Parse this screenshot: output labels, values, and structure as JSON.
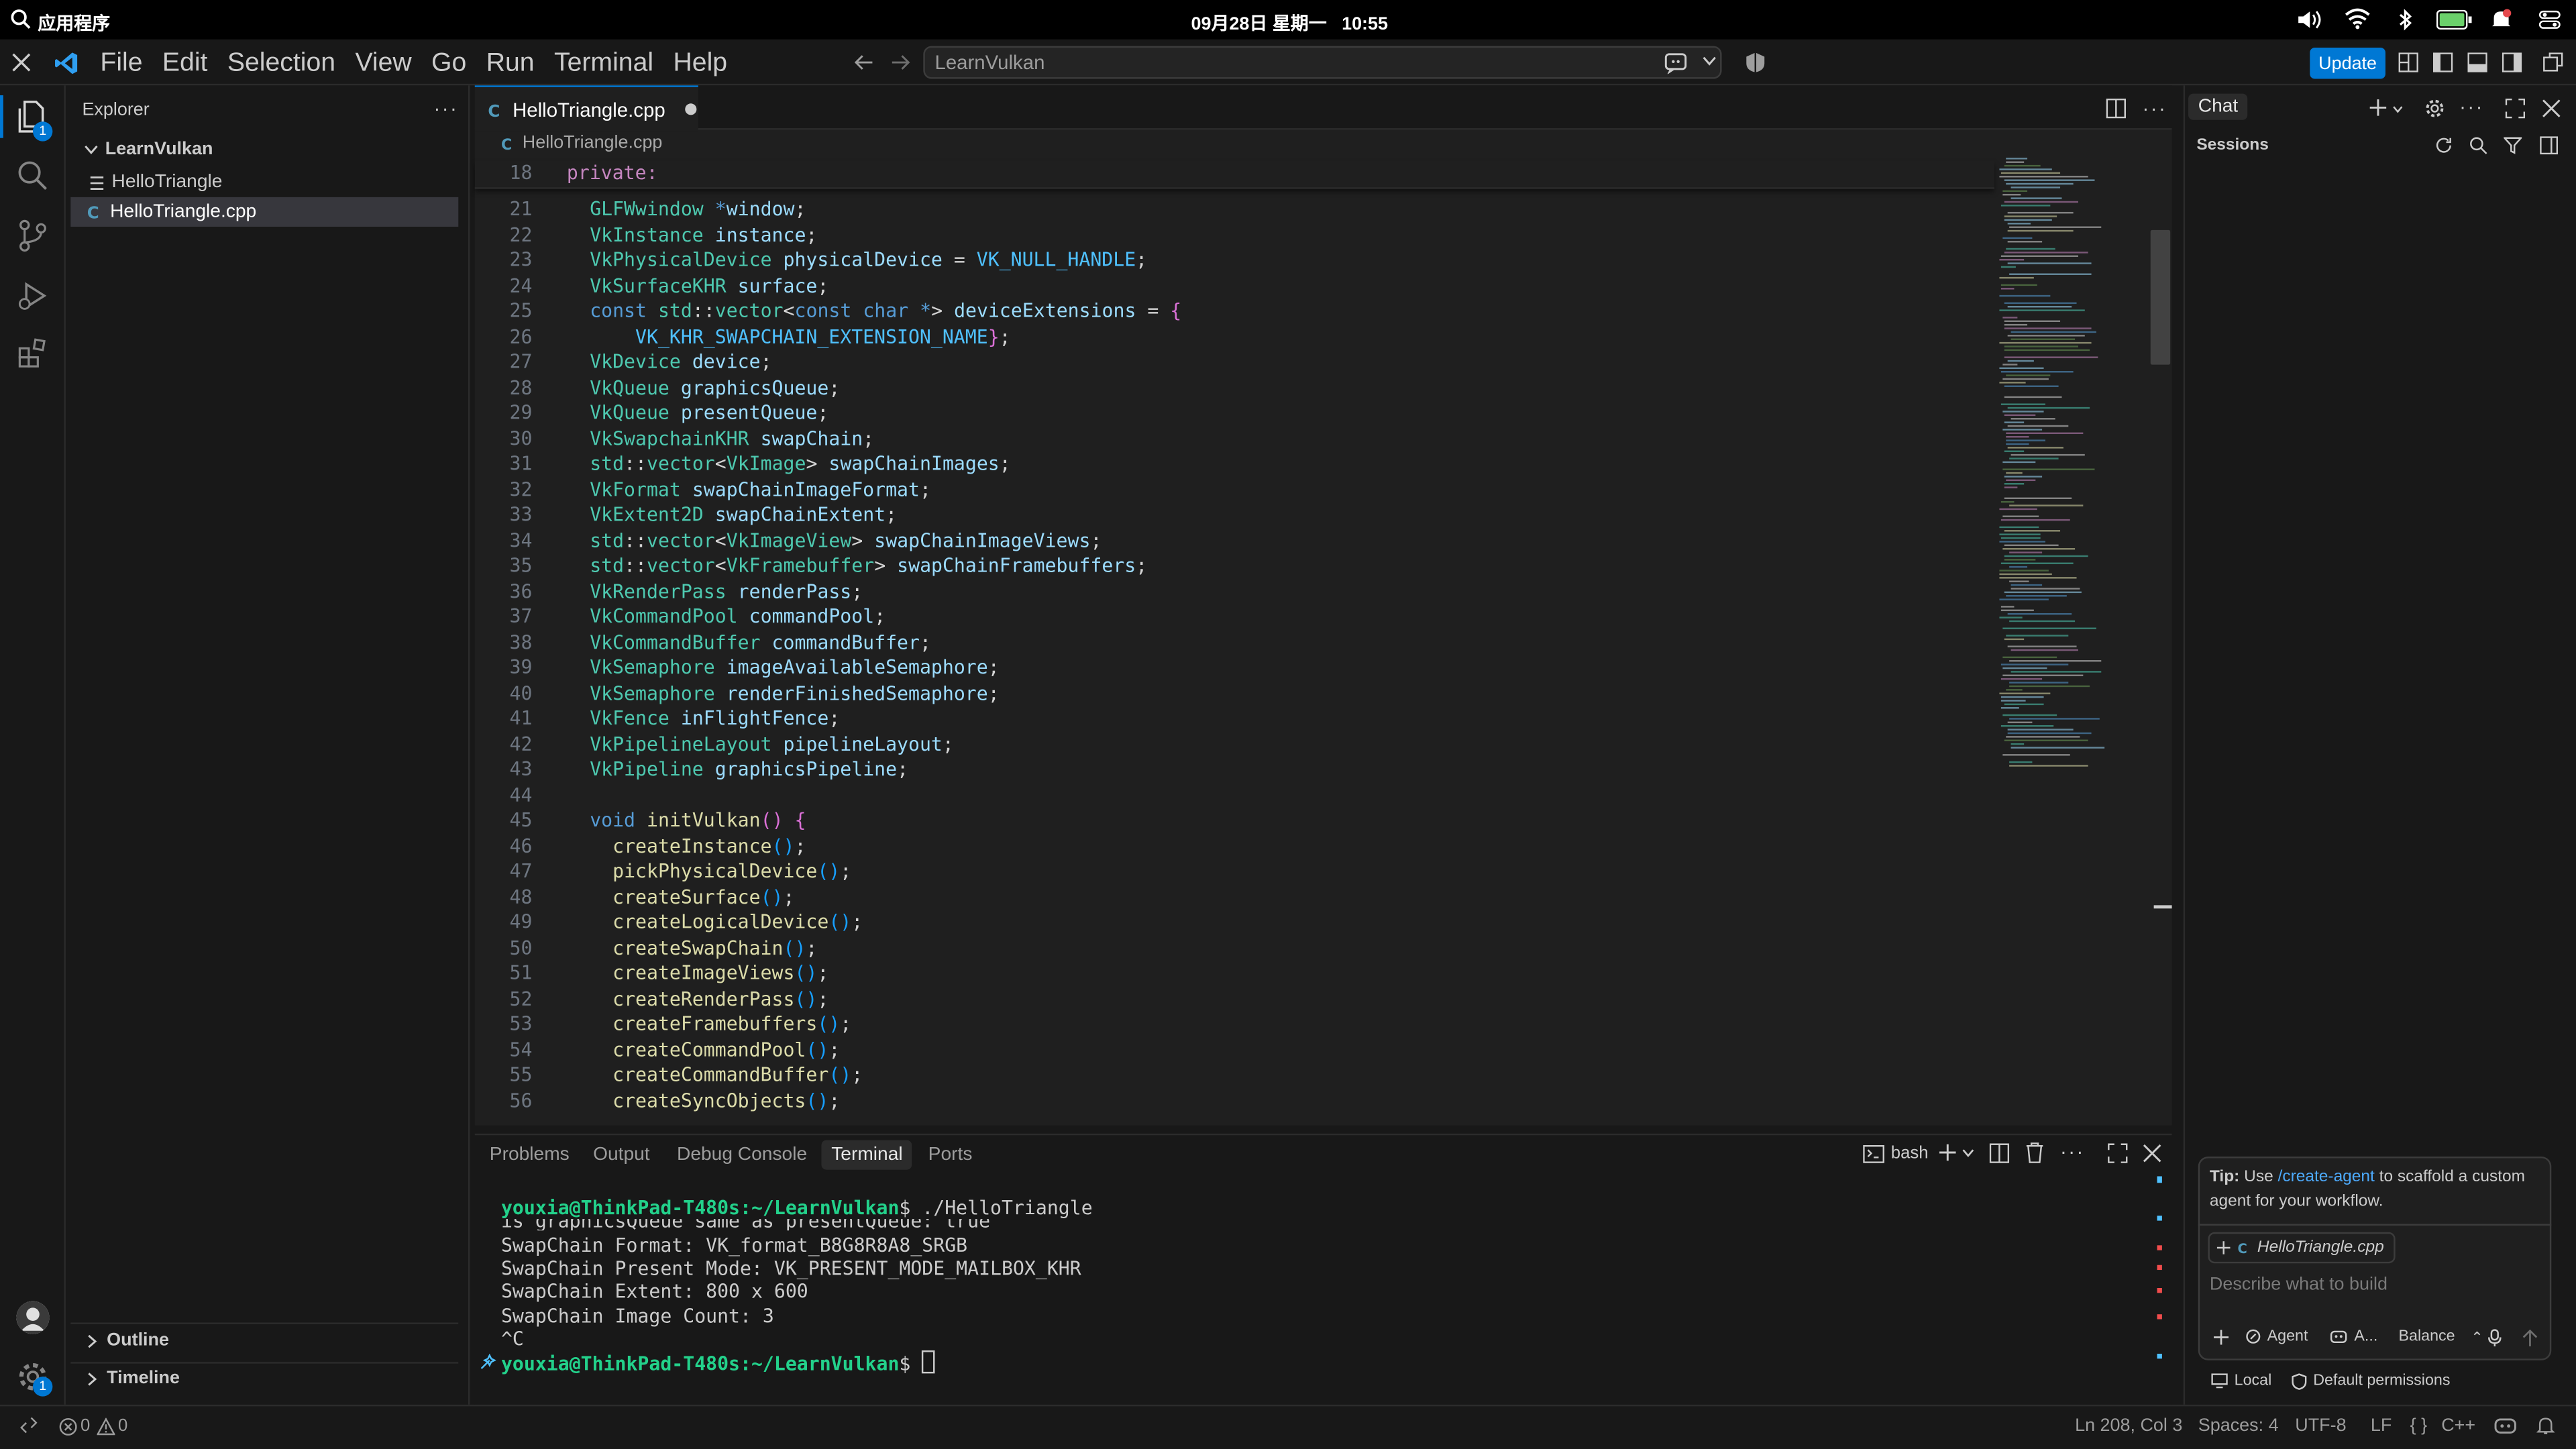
{
  "os_bar": {
    "app_menu": "应用程序",
    "datetime": "09月28日 星期一   10:55"
  },
  "menu": {
    "items": [
      "File",
      "Edit",
      "Selection",
      "View",
      "Go",
      "Run",
      "Terminal",
      "Help"
    ]
  },
  "command_center": {
    "text": "LearnVulkan"
  },
  "update_button": "Update",
  "sidebar": {
    "title": "Explorer",
    "root_folder": "LearnVulkan",
    "files": [
      {
        "name": "HelloTriangle",
        "selected": false
      },
      {
        "name": "HelloTriangle.cpp",
        "selected": true
      }
    ],
    "outline": "Outline",
    "timeline": "Timeline"
  },
  "activity": {
    "explorer_badge": "1",
    "settings_badge": "1"
  },
  "editor": {
    "tab_label": "HelloTriangle.cpp",
    "tab_modified": true,
    "breadcrumb": "HelloTriangle.cpp",
    "sticky_line": {
      "number": "18",
      "text": "private:"
    },
    "lines": [
      {
        "n": "21",
        "tokens": [
          [
            "t",
            "GLFWwindow"
          ],
          [
            "d",
            " "
          ],
          [
            "k",
            "*"
          ],
          [
            "v",
            "window"
          ],
          [
            "d",
            ";"
          ]
        ]
      },
      {
        "n": "22",
        "tokens": [
          [
            "t",
            "VkInstance"
          ],
          [
            "d",
            " "
          ],
          [
            "v",
            "instance"
          ],
          [
            "d",
            ";"
          ]
        ]
      },
      {
        "n": "23",
        "tokens": [
          [
            "t",
            "VkPhysicalDevice"
          ],
          [
            "d",
            " "
          ],
          [
            "v",
            "physicalDevice"
          ],
          [
            "d",
            " = "
          ],
          [
            "c",
            "VK_NULL_HANDLE"
          ],
          [
            "d",
            ";"
          ]
        ]
      },
      {
        "n": "24",
        "tokens": [
          [
            "t",
            "VkSurfaceKHR"
          ],
          [
            "d",
            " "
          ],
          [
            "v",
            "surface"
          ],
          [
            "d",
            ";"
          ]
        ]
      },
      {
        "n": "25",
        "tokens": [
          [
            "k",
            "const"
          ],
          [
            "d",
            " "
          ],
          [
            "t",
            "std"
          ],
          [
            "d",
            "::"
          ],
          [
            "t",
            "vector"
          ],
          [
            "d",
            "<"
          ],
          [
            "k",
            "const"
          ],
          [
            "d",
            " "
          ],
          [
            "k",
            "char"
          ],
          [
            "d",
            " "
          ],
          [
            "k",
            "*"
          ],
          [
            "d",
            "> "
          ],
          [
            "v",
            "deviceExtensions"
          ],
          [
            "d",
            " = "
          ],
          [
            "p",
            "{"
          ]
        ]
      },
      {
        "n": "26",
        "tokens": [
          [
            "d",
            "    "
          ],
          [
            "c",
            "VK_KHR_SWAPCHAIN_EXTENSION_NAME"
          ],
          [
            "p",
            "}"
          ],
          [
            "d",
            ";"
          ]
        ]
      },
      {
        "n": "27",
        "tokens": [
          [
            "t",
            "VkDevice"
          ],
          [
            "d",
            " "
          ],
          [
            "v",
            "device"
          ],
          [
            "d",
            ";"
          ]
        ]
      },
      {
        "n": "28",
        "tokens": [
          [
            "t",
            "VkQueue"
          ],
          [
            "d",
            " "
          ],
          [
            "v",
            "graphicsQueue"
          ],
          [
            "d",
            ";"
          ]
        ]
      },
      {
        "n": "29",
        "tokens": [
          [
            "t",
            "VkQueue"
          ],
          [
            "d",
            " "
          ],
          [
            "v",
            "presentQueue"
          ],
          [
            "d",
            ";"
          ]
        ]
      },
      {
        "n": "30",
        "tokens": [
          [
            "t",
            "VkSwapchainKHR"
          ],
          [
            "d",
            " "
          ],
          [
            "v",
            "swapChain"
          ],
          [
            "d",
            ";"
          ]
        ]
      },
      {
        "n": "31",
        "tokens": [
          [
            "t",
            "std"
          ],
          [
            "d",
            "::"
          ],
          [
            "t",
            "vector"
          ],
          [
            "d",
            "<"
          ],
          [
            "t",
            "VkImage"
          ],
          [
            "d",
            "> "
          ],
          [
            "v",
            "swapChainImages"
          ],
          [
            "d",
            ";"
          ]
        ]
      },
      {
        "n": "32",
        "tokens": [
          [
            "t",
            "VkFormat"
          ],
          [
            "d",
            " "
          ],
          [
            "v",
            "swapChainImageFormat"
          ],
          [
            "d",
            ";"
          ]
        ]
      },
      {
        "n": "33",
        "tokens": [
          [
            "t",
            "VkExtent2D"
          ],
          [
            "d",
            " "
          ],
          [
            "v",
            "swapChainExtent"
          ],
          [
            "d",
            ";"
          ]
        ]
      },
      {
        "n": "34",
        "tokens": [
          [
            "t",
            "std"
          ],
          [
            "d",
            "::"
          ],
          [
            "t",
            "vector"
          ],
          [
            "d",
            "<"
          ],
          [
            "t",
            "VkImageView"
          ],
          [
            "d",
            "> "
          ],
          [
            "v",
            "swapChainImageViews"
          ],
          [
            "d",
            ";"
          ]
        ]
      },
      {
        "n": "35",
        "tokens": [
          [
            "t",
            "std"
          ],
          [
            "d",
            "::"
          ],
          [
            "t",
            "vector"
          ],
          [
            "d",
            "<"
          ],
          [
            "t",
            "VkFramebuffer"
          ],
          [
            "d",
            "> "
          ],
          [
            "v",
            "swapChainFramebuffers"
          ],
          [
            "d",
            ";"
          ]
        ]
      },
      {
        "n": "36",
        "tokens": [
          [
            "t",
            "VkRenderPass"
          ],
          [
            "d",
            " "
          ],
          [
            "v",
            "renderPass"
          ],
          [
            "d",
            ";"
          ]
        ]
      },
      {
        "n": "37",
        "tokens": [
          [
            "t",
            "VkCommandPool"
          ],
          [
            "d",
            " "
          ],
          [
            "v",
            "commandPool"
          ],
          [
            "d",
            ";"
          ]
        ]
      },
      {
        "n": "38",
        "tokens": [
          [
            "t",
            "VkCommandBuffer"
          ],
          [
            "d",
            " "
          ],
          [
            "v",
            "commandBuffer"
          ],
          [
            "d",
            ";"
          ]
        ]
      },
      {
        "n": "39",
        "tokens": [
          [
            "t",
            "VkSemaphore"
          ],
          [
            "d",
            " "
          ],
          [
            "v",
            "imageAvailableSemaphore"
          ],
          [
            "d",
            ";"
          ]
        ]
      },
      {
        "n": "40",
        "tokens": [
          [
            "t",
            "VkSemaphore"
          ],
          [
            "d",
            " "
          ],
          [
            "v",
            "renderFinishedSemaphore"
          ],
          [
            "d",
            ";"
          ]
        ]
      },
      {
        "n": "41",
        "tokens": [
          [
            "t",
            "VkFence"
          ],
          [
            "d",
            " "
          ],
          [
            "v",
            "inFlightFence"
          ],
          [
            "d",
            ";"
          ]
        ]
      },
      {
        "n": "42",
        "tokens": [
          [
            "t",
            "VkPipelineLayout"
          ],
          [
            "d",
            " "
          ],
          [
            "v",
            "pipelineLayout"
          ],
          [
            "d",
            ";"
          ]
        ]
      },
      {
        "n": "43",
        "tokens": [
          [
            "t",
            "VkPipeline"
          ],
          [
            "d",
            " "
          ],
          [
            "v",
            "graphicsPipeline"
          ],
          [
            "d",
            ";"
          ]
        ]
      },
      {
        "n": "44",
        "tokens": []
      },
      {
        "n": "45",
        "tokens": [
          [
            "k",
            "void"
          ],
          [
            "d",
            " "
          ],
          [
            "f",
            "initVulkan"
          ],
          [
            "p",
            "()"
          ],
          [
            "d",
            " "
          ],
          [
            "p",
            "{"
          ]
        ]
      },
      {
        "n": "46",
        "tokens": [
          [
            "d",
            "  "
          ],
          [
            "f",
            "createInstance"
          ],
          [
            "pb",
            "()"
          ],
          [
            "d",
            ";"
          ]
        ]
      },
      {
        "n": "47",
        "tokens": [
          [
            "d",
            "  "
          ],
          [
            "f",
            "pickPhysicalDevice"
          ],
          [
            "pb",
            "()"
          ],
          [
            "d",
            ";"
          ]
        ]
      },
      {
        "n": "48",
        "tokens": [
          [
            "d",
            "  "
          ],
          [
            "f",
            "createSurface"
          ],
          [
            "pb",
            "()"
          ],
          [
            "d",
            ";"
          ]
        ]
      },
      {
        "n": "49",
        "tokens": [
          [
            "d",
            "  "
          ],
          [
            "f",
            "createLogicalDevice"
          ],
          [
            "pb",
            "()"
          ],
          [
            "d",
            ";"
          ]
        ]
      },
      {
        "n": "50",
        "tokens": [
          [
            "d",
            "  "
          ],
          [
            "f",
            "createSwapChain"
          ],
          [
            "pb",
            "()"
          ],
          [
            "d",
            ";"
          ]
        ]
      },
      {
        "n": "51",
        "tokens": [
          [
            "d",
            "  "
          ],
          [
            "f",
            "createImageViews"
          ],
          [
            "pb",
            "()"
          ],
          [
            "d",
            ";"
          ]
        ]
      },
      {
        "n": "52",
        "tokens": [
          [
            "d",
            "  "
          ],
          [
            "f",
            "createRenderPass"
          ],
          [
            "pb",
            "()"
          ],
          [
            "d",
            ";"
          ]
        ]
      },
      {
        "n": "53",
        "tokens": [
          [
            "d",
            "  "
          ],
          [
            "f",
            "createFramebuffers"
          ],
          [
            "pb",
            "()"
          ],
          [
            "d",
            ";"
          ]
        ]
      },
      {
        "n": "54",
        "tokens": [
          [
            "d",
            "  "
          ],
          [
            "f",
            "createCommandPool"
          ],
          [
            "pb",
            "()"
          ],
          [
            "d",
            ";"
          ]
        ]
      },
      {
        "n": "55",
        "tokens": [
          [
            "d",
            "  "
          ],
          [
            "f",
            "createCommandBuffer"
          ],
          [
            "pb",
            "()"
          ],
          [
            "d",
            ";"
          ]
        ]
      },
      {
        "n": "56",
        "tokens": [
          [
            "d",
            "  "
          ],
          [
            "f",
            "createSyncObjects"
          ],
          [
            "pb",
            "()"
          ],
          [
            "d",
            ";"
          ]
        ]
      }
    ]
  },
  "panel": {
    "tabs": [
      "Problems",
      "Output",
      "Debug Console",
      "Terminal",
      "Ports"
    ],
    "active_tab": "Terminal",
    "shell": "bash",
    "terminal": {
      "prompt": "youxia@ThinkPad-T480s:~/LearnVulkan",
      "command": "$ ./HelloTriangle",
      "partial_line": "is graphicsQueue same as presentQueue: true",
      "output": [
        "SwapChain Format: VK_format_B8G8R8A8_SRGB",
        "SwapChain Present Mode: VK_PRESENT_MODE_MAILBOX_KHR",
        "SwapChain Extent: 800 x 600",
        "SwapChain Image Count: 3",
        "^C"
      ],
      "final_prompt_suffix": "$ "
    }
  },
  "chat": {
    "tab": "Chat",
    "sessions": "Sessions",
    "tip_prefix": "Tip:",
    "tip_text1": " Use ",
    "tip_link": "/create-agent",
    "tip_text2": " to scaffold a custom agent for your workflow.",
    "context_file": "HelloTriangle.cpp",
    "input_placeholder": "Describe what to build",
    "agent_label": "Agent",
    "model_label": "A...",
    "mode_label": "Balance",
    "local_label": "Local",
    "permissions_label": "Default permissions"
  },
  "status": {
    "errors": "0",
    "warnings": "0",
    "cursor": "Ln 208, Col 3",
    "spaces": "Spaces: 4",
    "encoding": "UTF-8",
    "eol": "LF",
    "language": "C++"
  },
  "colors": {
    "accent": "#0078d4",
    "badge": "#0078d4"
  }
}
